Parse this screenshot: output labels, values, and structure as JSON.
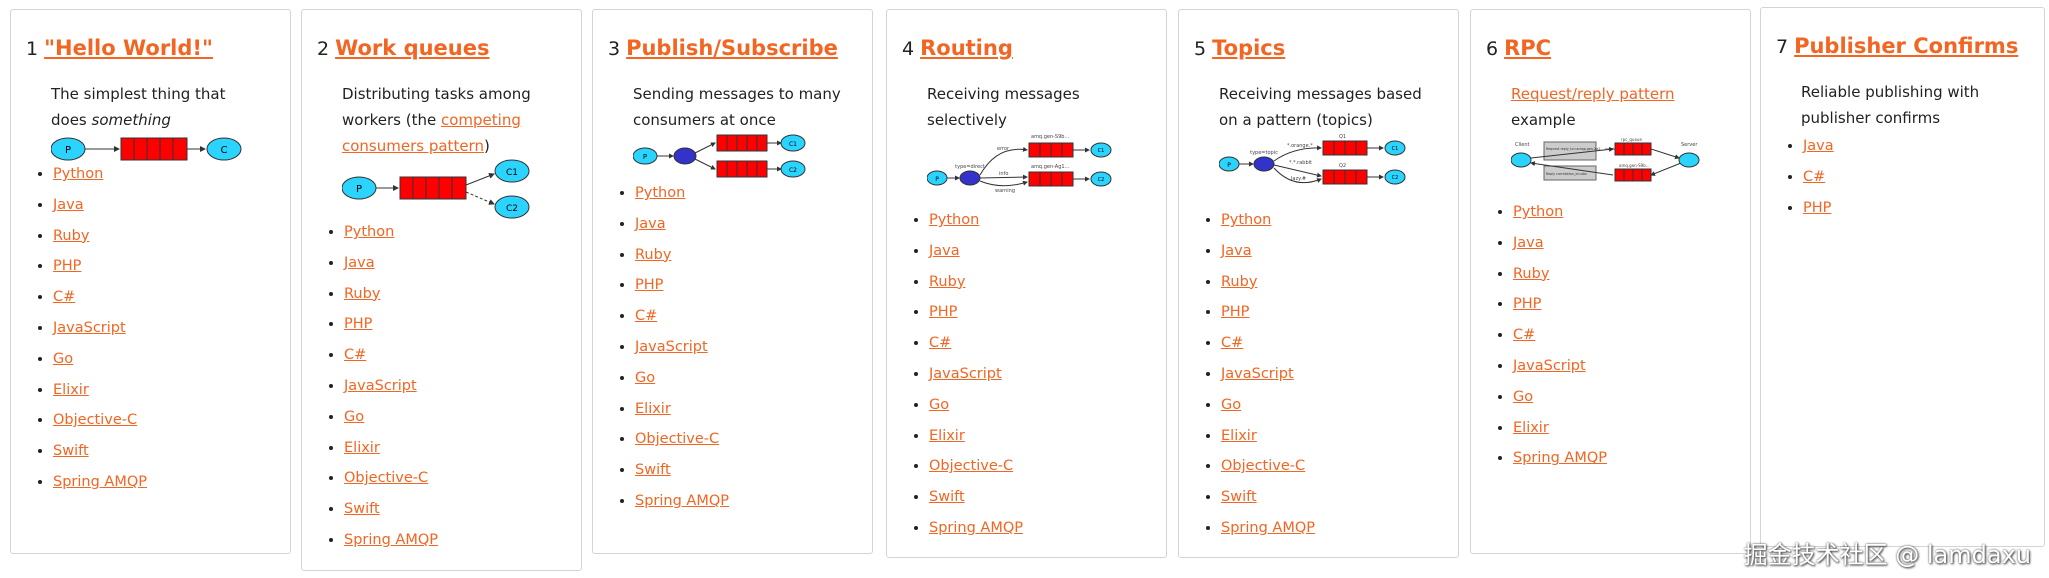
{
  "tutorials": [
    {
      "number": "1",
      "title": "\"Hello World!\"",
      "desc_a": "The simplest thing that does ",
      "desc_em": "something",
      "langs": [
        "Python",
        "Java",
        "Ruby",
        "PHP",
        "C#",
        "JavaScript",
        "Go",
        "Elixir",
        "Objective-C",
        "Swift",
        "Spring AMQP"
      ]
    },
    {
      "number": "2",
      "title": "Work queues",
      "desc_a": "Distributing tasks among workers (the ",
      "desc_link": "competing consumers pattern",
      "desc_b": ")",
      "langs": [
        "Python",
        "Java",
        "Ruby",
        "PHP",
        "C#",
        "JavaScript",
        "Go",
        "Elixir",
        "Objective-C",
        "Swift",
        "Spring AMQP"
      ]
    },
    {
      "number": "3",
      "title": "Publish/Subscribe",
      "desc": "Sending messages to many consumers at once",
      "langs": [
        "Python",
        "Java",
        "Ruby",
        "PHP",
        "C#",
        "JavaScript",
        "Go",
        "Elixir",
        "Objective-C",
        "Swift",
        "Spring AMQP"
      ]
    },
    {
      "number": "4",
      "title": "Routing",
      "desc": "Receiving messages selectively",
      "langs": [
        "Python",
        "Java",
        "Ruby",
        "PHP",
        "C#",
        "JavaScript",
        "Go",
        "Elixir",
        "Objective-C",
        "Swift",
        "Spring AMQP"
      ]
    },
    {
      "number": "5",
      "title": "Topics",
      "desc": "Receiving messages based on a pattern (topics)",
      "langs": [
        "Python",
        "Java",
        "Ruby",
        "PHP",
        "C#",
        "JavaScript",
        "Go",
        "Elixir",
        "Objective-C",
        "Swift",
        "Spring AMQP"
      ]
    },
    {
      "number": "6",
      "title": "RPC",
      "desc_link": "Request/reply pattern",
      "desc_b": " example",
      "langs": [
        "Python",
        "Java",
        "Ruby",
        "PHP",
        "C#",
        "JavaScript",
        "Go",
        "Elixir",
        "Spring AMQP"
      ]
    },
    {
      "number": "7",
      "title": "Publisher Confirms",
      "desc": "Reliable publishing with publisher confirms",
      "langs": [
        "Java",
        "C#",
        "PHP"
      ]
    }
  ],
  "diagram_labels": {
    "producer": "P",
    "consumer": "C",
    "c1": "C1",
    "c2": "C2",
    "routing_error": "error",
    "routing_info": "info",
    "routing_warning": "warning",
    "topic_orange": "*.orange.*",
    "topic_rabbit": "*.*.rabbit",
    "topic_lazy": "lazy.#",
    "q1": "Q1",
    "q2": "Q2",
    "x_direct": "type=direct",
    "x_topic": "type=topic",
    "rpc_client": "Client",
    "rpc_server": "Server",
    "rpc_queue": "rpc_queue",
    "rpc_request": "Request reply_to=amqp.gen-Xa2... correlation_id=abc",
    "rpc_reply": "Reply correlation_id=abc",
    "amq_gen_1": "amq.gen-S9b...",
    "amq_gen_2": "amq.gen-Ag1..."
  },
  "colors": {
    "accent": "#f26522",
    "queue": "#ff0000",
    "node": "#2ad4ff",
    "exchange": "#3333cc"
  },
  "watermark": "掘金技术社区 @ lamdaxu"
}
